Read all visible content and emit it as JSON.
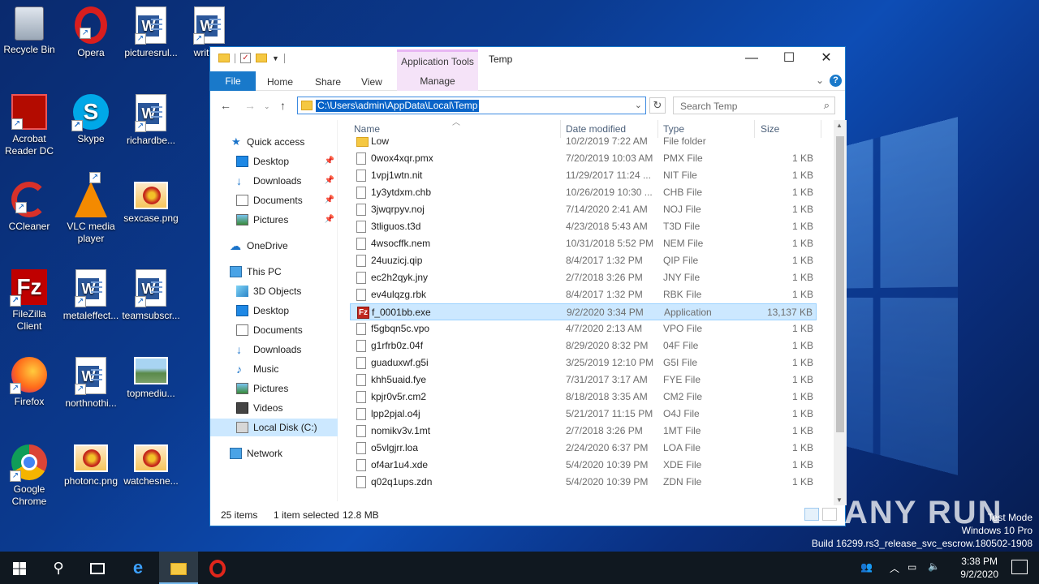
{
  "desktop": {
    "icons": [
      {
        "label": "Recycle Bin"
      },
      {
        "label": "Opera"
      },
      {
        "label": "picturesrul..."
      },
      {
        "label": "writte..."
      },
      {
        "label": "Acrobat Reader DC"
      },
      {
        "label": "Skype"
      },
      {
        "label": "richardbe..."
      },
      {
        "label": "CCleaner"
      },
      {
        "label": "VLC media player"
      },
      {
        "label": "sexcase.png"
      },
      {
        "label": "FileZilla Client"
      },
      {
        "label": "metaleffect..."
      },
      {
        "label": "teamsubscr..."
      },
      {
        "label": "Firefox"
      },
      {
        "label": "northnothi..."
      },
      {
        "label": "topmediu..."
      },
      {
        "label": "Google Chrome"
      },
      {
        "label": "photonc.png"
      },
      {
        "label": "watchesne..."
      }
    ]
  },
  "window": {
    "title": "Temp",
    "context_tab_group": "Application Tools",
    "ribbon_tabs": {
      "file": "File",
      "home": "Home",
      "share": "Share",
      "view": "View",
      "manage": "Manage"
    },
    "controls": {
      "minimize": "—",
      "maximize": "☐",
      "close": "✕"
    },
    "address": {
      "path": "C:\\Users\\admin\\AppData\\Local\\Temp"
    },
    "search": {
      "placeholder": "Search Temp"
    },
    "nav": {
      "quick_access": "Quick access",
      "qa_items": [
        "Desktop",
        "Downloads",
        "Documents",
        "Pictures"
      ],
      "onedrive": "OneDrive",
      "this_pc": "This PC",
      "pc_items": [
        "3D Objects",
        "Desktop",
        "Documents",
        "Downloads",
        "Music",
        "Pictures",
        "Videos",
        "Local Disk (C:)"
      ],
      "network": "Network"
    },
    "columns": {
      "name": "Name",
      "date": "Date modified",
      "type": "Type",
      "size": "Size"
    },
    "files": [
      {
        "name": "Low",
        "date": "10/2/2019 7:22 AM",
        "type": "File folder",
        "size": ""
      },
      {
        "name": "0wox4xqr.pmx",
        "date": "7/20/2019 10:03 AM",
        "type": "PMX File",
        "size": "1 KB"
      },
      {
        "name": "1vpj1wtn.nit",
        "date": "11/29/2017 11:24 ...",
        "type": "NIT File",
        "size": "1 KB"
      },
      {
        "name": "1y3ytdxm.chb",
        "date": "10/26/2019 10:30 ...",
        "type": "CHB File",
        "size": "1 KB"
      },
      {
        "name": "3jwqrpyv.noj",
        "date": "7/14/2020 2:41 AM",
        "type": "NOJ File",
        "size": "1 KB"
      },
      {
        "name": "3tliguos.t3d",
        "date": "4/23/2018 5:43 AM",
        "type": "T3D File",
        "size": "1 KB"
      },
      {
        "name": "4wsocffk.nem",
        "date": "10/31/2018 5:52 PM",
        "type": "NEM File",
        "size": "1 KB"
      },
      {
        "name": "24uuzicj.qip",
        "date": "8/4/2017 1:32 PM",
        "type": "QIP File",
        "size": "1 KB"
      },
      {
        "name": "ec2h2qyk.jny",
        "date": "2/7/2018 3:26 PM",
        "type": "JNY File",
        "size": "1 KB"
      },
      {
        "name": "ev4ulqzg.rbk",
        "date": "8/4/2017 1:32 PM",
        "type": "RBK File",
        "size": "1 KB"
      },
      {
        "name": "f_0001bb.exe",
        "date": "9/2/2020 3:34 PM",
        "type": "Application",
        "size": "13,137 KB"
      },
      {
        "name": "f5gbqn5c.vpo",
        "date": "4/7/2020 2:13 AM",
        "type": "VPO File",
        "size": "1 KB"
      },
      {
        "name": "g1rfrb0z.04f",
        "date": "8/29/2020 8:32 PM",
        "type": "04F File",
        "size": "1 KB"
      },
      {
        "name": "guaduxwf.g5i",
        "date": "3/25/2019 12:10 PM",
        "type": "G5I File",
        "size": "1 KB"
      },
      {
        "name": "khh5uaid.fye",
        "date": "7/31/2017 3:17 AM",
        "type": "FYE File",
        "size": "1 KB"
      },
      {
        "name": "kpjr0v5r.cm2",
        "date": "8/18/2018 3:35 AM",
        "type": "CM2 File",
        "size": "1 KB"
      },
      {
        "name": "lpp2pjal.o4j",
        "date": "5/21/2017 11:15 PM",
        "type": "O4J File",
        "size": "1 KB"
      },
      {
        "name": "nomikv3v.1mt",
        "date": "2/7/2018 3:26 PM",
        "type": "1MT File",
        "size": "1 KB"
      },
      {
        "name": "o5vlgjrr.loa",
        "date": "2/24/2020 6:37 PM",
        "type": "LOA File",
        "size": "1 KB"
      },
      {
        "name": "of4ar1u4.xde",
        "date": "5/4/2020 10:39 PM",
        "type": "XDE File",
        "size": "1 KB"
      },
      {
        "name": "q02q1ups.zdn",
        "date": "5/4/2020 10:39 PM",
        "type": "ZDN File",
        "size": "1 KB"
      }
    ],
    "status": {
      "count": "25 items",
      "selected": "1 item selected",
      "size": "12.8 MB"
    }
  },
  "taskbar": {
    "clock_time": "3:38 PM",
    "clock_date": "9/2/2020"
  },
  "watermark": {
    "line1": "Test Mode",
    "line2": "Windows 10 Pro",
    "line3": "Build 16299.rs3_release_svc_escrow.180502-1908",
    "brand": "ANY RUN"
  }
}
